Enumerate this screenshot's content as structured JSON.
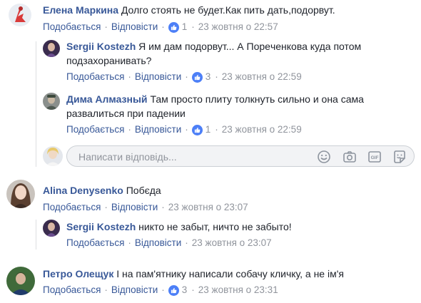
{
  "actions": {
    "like": "Подобається",
    "reply": "Відповісти",
    "separator": "·"
  },
  "comments": [
    {
      "author": "Елена Маркина",
      "text1": "Долго стоять не будет.Как пить дать,подорвут.",
      "likes": "1",
      "time": "23 жовтня о 22:57"
    },
    {
      "author": "Sergii Kostezh",
      "text1": "Я им дам подорвут... А Порeченкова куда потом",
      "text2": "подзахоранивать?",
      "likes": "3",
      "time": "23 жовтня о 22:59"
    },
    {
      "author": "Дима Алмазный",
      "text1": "Там просто плиту толкнуть сильно и она сама",
      "text2": "развалиться при падении",
      "likes": "1",
      "time": "23 жовтня о 22:59"
    },
    {
      "author": "Alina Denysenko",
      "text1": "Побєда",
      "time": "23 жовтня о 23:07"
    },
    {
      "author": "Sergii Kostezh",
      "text1": "никто не забыт, ничто не забыто!",
      "time": "23 жовтня о 23:07"
    },
    {
      "author": "Петро Олещук",
      "text1": "І на пам'ятнику написали собачу кличку, а не ім'я",
      "likes": "3",
      "time": "23 жовтня о 23:31"
    }
  ],
  "reply_box": {
    "placeholder": "Написати відповідь...",
    "icons": [
      "emoji-icon",
      "camera-icon",
      "gif-icon",
      "sticker-icon"
    ]
  },
  "colors": {
    "link": "#385898",
    "meta": "#90949c",
    "like_badge": "#4c7ff7"
  }
}
